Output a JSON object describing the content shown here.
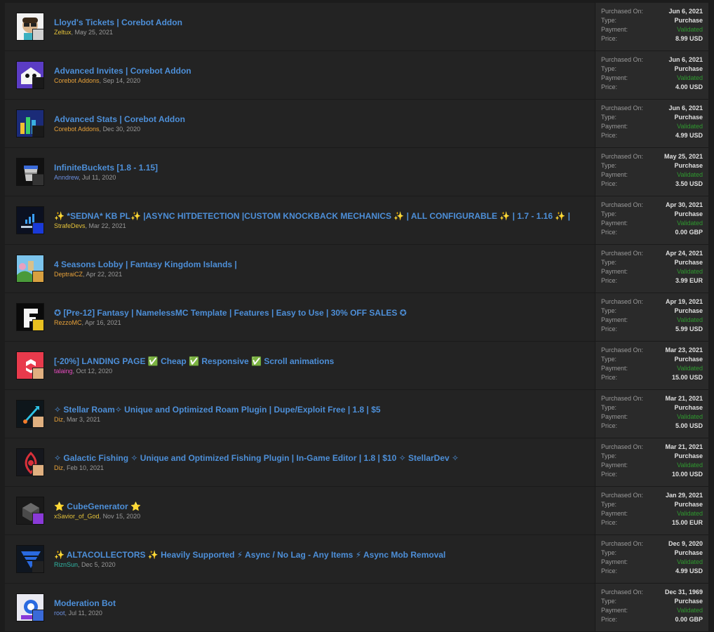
{
  "labels": {
    "purchased_on": "Purchased On:",
    "type": "Type:",
    "payment": "Payment:",
    "price": "Price:"
  },
  "items": [
    {
      "title": "Lloyd's Tickets | Corebot Addon",
      "author": "Zeltux",
      "date": "May 25, 2021",
      "purchased": "Jun 6, 2021",
      "type": "Purchase",
      "payment": "Validated",
      "price": "8.99 USD",
      "icon": "lloyds-tickets-icon"
    },
    {
      "title": "Advanced Invites | Corebot Addon",
      "author": "Corebot Addons",
      "date": "Sep 14, 2020",
      "purchased": "Jun 6, 2021",
      "type": "Purchase",
      "payment": "Validated",
      "price": "4.00 USD",
      "icon": "advanced-invites-icon"
    },
    {
      "title": "Advanced Stats | Corebot Addon",
      "author": "Corebot Addons",
      "date": "Dec 30, 2020",
      "purchased": "Jun 6, 2021",
      "type": "Purchase",
      "payment": "Validated",
      "price": "4.99 USD",
      "icon": "advanced-stats-icon"
    },
    {
      "title": "InfiniteBuckets [1.8 - 1.15]",
      "author": "Anndrew",
      "date": "Jul 11, 2020",
      "purchased": "May 25, 2021",
      "type": "Purchase",
      "payment": "Validated",
      "price": "3.50 USD",
      "icon": "bucket-icon"
    },
    {
      "title": "✨ *SEDNA* KB PL✨ |ASYNC HITDETECTION |CUSTOM KNOCKBACK MECHANICS ✨ | ALL CONFIGURABLE ✨ | 1.7 - 1.16 ✨ |",
      "author": "StrafeDevs",
      "date": "Mar 22, 2021",
      "purchased": "Apr 30, 2021",
      "type": "Purchase",
      "payment": "Validated",
      "price": "0.00 GBP",
      "icon": "sedna-icon"
    },
    {
      "title": "4 Seasons Lobby | Fantasy Kingdom Islands |",
      "author": "DeptraiCZ",
      "date": "Apr 22, 2021",
      "purchased": "Apr 24, 2021",
      "type": "Purchase",
      "payment": "Validated",
      "price": "3.99 EUR",
      "icon": "seasons-lobby-icon"
    },
    {
      "title": "✪ [Pre-12] Fantasy | NamelessMC Template | Features | Easy to Use | 30% OFF SALES ✪",
      "author": "RezzoMC",
      "date": "Apr 16, 2021",
      "purchased": "Apr 19, 2021",
      "type": "Purchase",
      "payment": "Validated",
      "price": "5.99 USD",
      "icon": "fantasy-f-icon"
    },
    {
      "title": "[-20%] LANDING PAGE ✅ Cheap ✅ Responsive ✅ Scroll animations",
      "author": "talaing",
      "date": "Oct 12, 2020",
      "purchased": "Mar 23, 2021",
      "type": "Purchase",
      "payment": "Validated",
      "price": "15.00 USD",
      "icon": "landing-page-icon"
    },
    {
      "title": "✧ Stellar Roam✧ Unique and Optimized Roam Plugin | Dupe/Exploit Free | 1.8 | $5",
      "author": "Diz",
      "date": "Mar 3, 2021",
      "purchased": "Mar 21, 2021",
      "type": "Purchase",
      "payment": "Validated",
      "price": "5.00 USD",
      "icon": "rocket-icon"
    },
    {
      "title": "✧ Galactic Fishing ✧ Unique and Optimized Fishing Plugin | In-Game Editor | 1.8 | $10 ✧ StellarDev ✧",
      "author": "Diz",
      "date": "Feb 10, 2021",
      "purchased": "Mar 21, 2021",
      "type": "Purchase",
      "payment": "Validated",
      "price": "10.00 USD",
      "icon": "fishing-icon"
    },
    {
      "title": "⭐ CubeGenerator ⭐",
      "author": "xSavior_of_God",
      "date": "Nov 15, 2020",
      "purchased": "Jan 29, 2021",
      "type": "Purchase",
      "payment": "Validated",
      "price": "15.00 EUR",
      "icon": "cube-generator-icon"
    },
    {
      "title": "✨ ALTACOLLECTORS ✨ Heavily Supported ⚡ Async / No Lag - Any Items ⚡ Async Mob Removal",
      "author": "RiznSun",
      "date": "Dec 5, 2020",
      "purchased": "Dec 9, 2020",
      "type": "Purchase",
      "payment": "Validated",
      "price": "4.99 USD",
      "icon": "funnel-icon"
    },
    {
      "title": "Moderation Bot",
      "author": "root",
      "date": "Jul 11, 2020",
      "purchased": "Dec 31, 1969",
      "type": "Purchase",
      "payment": "Validated",
      "price": "0.00 GBP",
      "icon": "moderation-bot-icon"
    }
  ],
  "colors": {
    "link": "#4d8fd8",
    "validated": "#2f9a2f",
    "row_bg": "#232323",
    "side_bg": "#2a2a2a"
  }
}
